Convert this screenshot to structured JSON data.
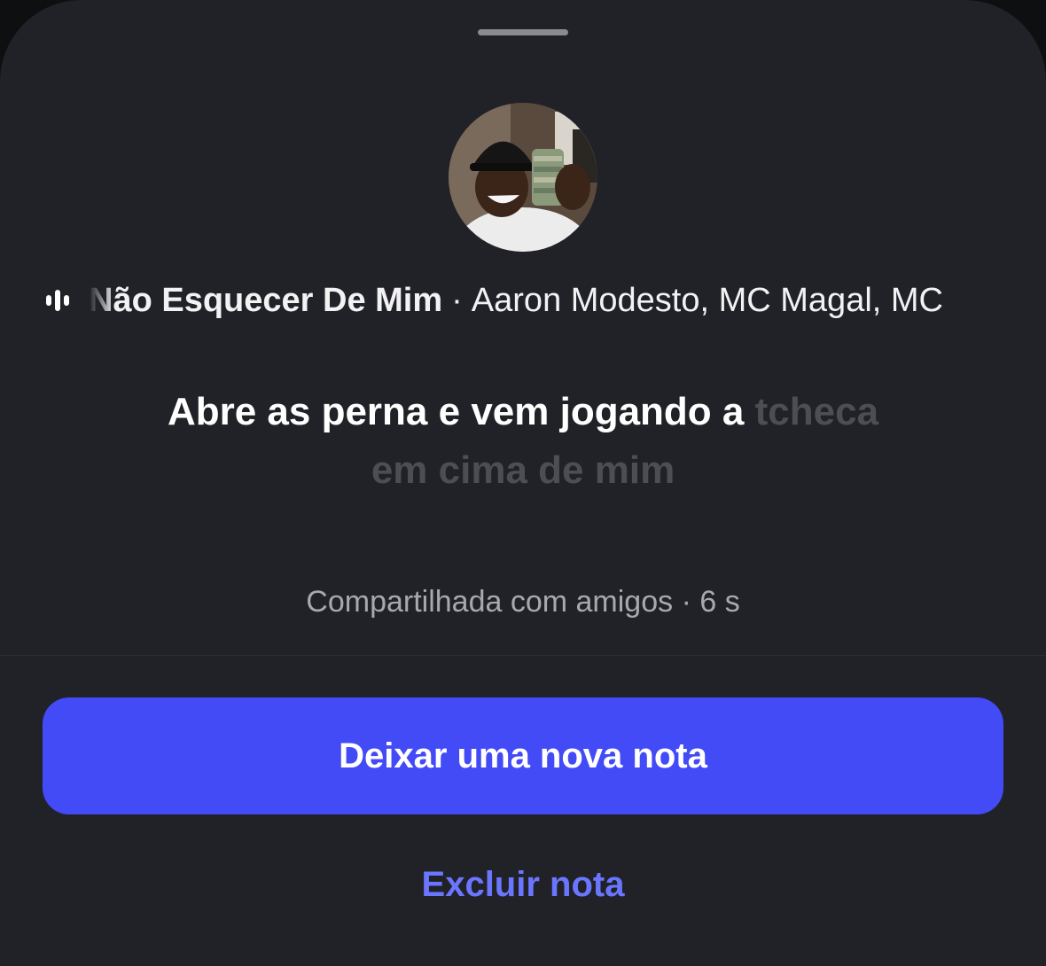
{
  "note_sheet": {
    "avatar_icon": "profile-photo",
    "music": {
      "icon": "audio-bars-icon",
      "title": "Não Esquecer De Mim",
      "separator": "·",
      "artists": "Aaron Modesto, MC Magal, MC"
    },
    "lyrics": {
      "line1_active": "Abre as perna e vem jogando a",
      "line1_rest": "tcheca",
      "line2": "em cima de mim"
    },
    "shared_info": "Compartilhada com amigos · 6 s",
    "actions": {
      "primary_label": "Deixar uma nova nota",
      "delete_label": "Excluir nota"
    },
    "colors": {
      "background": "#212227",
      "primary_button": "#434bf7",
      "link": "#6b76ff",
      "lyric_active": "#ffffff",
      "lyric_dim": "#4d4e53"
    }
  }
}
